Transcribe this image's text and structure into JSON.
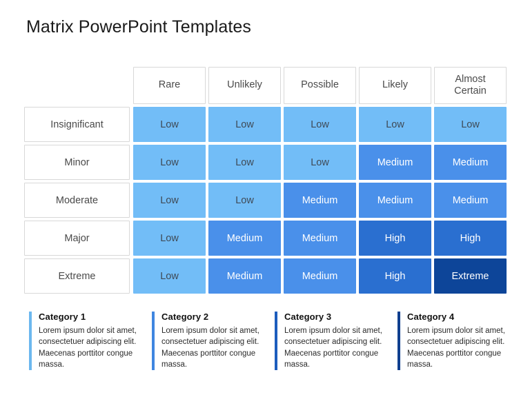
{
  "title": "Matrix PowerPoint Templates",
  "matrix": {
    "column_headers": [
      "Rare",
      "Unlikely",
      "Possible",
      "Likely",
      "Almost Certain"
    ],
    "row_headers": [
      "Insignificant",
      "Minor",
      "Moderate",
      "Major",
      "Extreme"
    ],
    "levels": {
      "low": "Low",
      "medium": "Medium",
      "high": "High",
      "extreme": "Extreme"
    },
    "colors": {
      "low": "#72bdf7",
      "medium": "#4a90ea",
      "high": "#2a6fd0",
      "extreme": "#0d4599",
      "header_bg": "#ffffff",
      "header_border": "#d8d8d8"
    },
    "cells": [
      [
        "Low",
        "Low",
        "Low",
        "Low",
        "Low"
      ],
      [
        "Low",
        "Low",
        "Low",
        "Medium",
        "Medium"
      ],
      [
        "Low",
        "Low",
        "Medium",
        "Medium",
        "Medium"
      ],
      [
        "Low",
        "Medium",
        "Medium",
        "High",
        "High"
      ],
      [
        "Low",
        "Medium",
        "Medium",
        "High",
        "Extreme"
      ]
    ],
    "cell_levels": [
      [
        "low",
        "low",
        "low",
        "low",
        "low"
      ],
      [
        "low",
        "low",
        "low",
        "medium",
        "medium"
      ],
      [
        "low",
        "low",
        "medium",
        "medium",
        "medium"
      ],
      [
        "low",
        "medium",
        "medium",
        "high",
        "high"
      ],
      [
        "low",
        "medium",
        "medium",
        "high",
        "extreme"
      ]
    ]
  },
  "cards": [
    {
      "title": "Category 1",
      "text": "Lorem ipsum dolor sit amet, consectetuer adipiscing elit. Maecenas porttitor congue massa.",
      "bar_color": "#6cb8ef"
    },
    {
      "title": "Category 2",
      "text": "Lorem ipsum dolor sit amet, consectetuer adipiscing elit. Maecenas porttitor congue massa.",
      "bar_color": "#3f86e0"
    },
    {
      "title": "Category 3",
      "text": "Lorem ipsum dolor sit amet, consectetuer adipiscing elit. Maecenas porttitor congue massa.",
      "bar_color": "#1d5dbd"
    },
    {
      "title": "Category 4",
      "text": "Lorem ipsum dolor sit amet, consectetuer adipiscing elit. Maecenas porttitor congue massa.",
      "bar_color": "#0f3f8f"
    }
  ]
}
